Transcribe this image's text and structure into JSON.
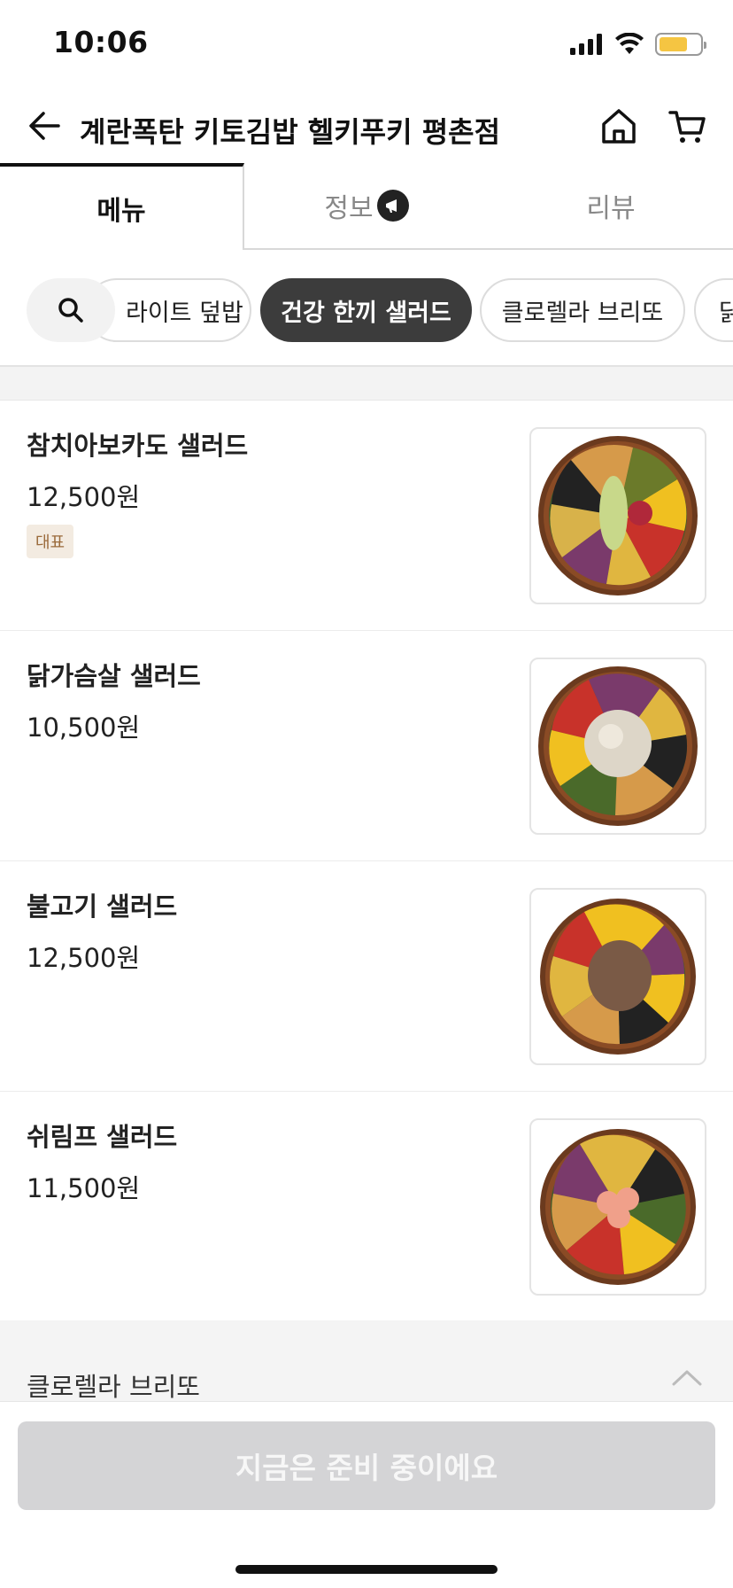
{
  "status_bar": {
    "time": "10:06",
    "icons": [
      "cellular-signal-icon",
      "wifi-icon",
      "battery-icon"
    ],
    "battery_color": "#f5c542"
  },
  "header": {
    "store_title": "계란폭탄 키토김밥 헬키푸키 평촌점",
    "icons": [
      "back-arrow-icon",
      "home-icon",
      "cart-icon"
    ]
  },
  "tabs": [
    {
      "label": "메뉴",
      "active": true
    },
    {
      "label": "정보",
      "active": false,
      "icon": "megaphone-icon"
    },
    {
      "label": "리뷰",
      "active": false
    }
  ],
  "categories": {
    "search_icon": "search-icon",
    "chips": [
      {
        "label": "라이트 덮밥",
        "display": "라이트 덮밥",
        "active": false
      },
      {
        "label": "건강 한끼 샐러드",
        "active": true
      },
      {
        "label": "클로렐라 브리또",
        "active": false
      },
      {
        "label": "닭",
        "active": false
      }
    ]
  },
  "menu_items": [
    {
      "name": "참치아보카도 샐러드",
      "price": "12,500원",
      "badge": "대표",
      "image": "tuna-avocado-salad-bowl"
    },
    {
      "name": "닭가슴살 샐러드",
      "price": "10,500원",
      "image": "chicken-breast-salad-bowl"
    },
    {
      "name": "불고기 샐러드",
      "price": "12,500원",
      "image": "bulgogi-salad-bowl"
    },
    {
      "name": "쉬림프 샐러드",
      "price": "11,500원",
      "image": "shrimp-salad-bowl"
    }
  ],
  "collapsed_section": {
    "title": "클로렐라 브리또",
    "icon": "chevron-up-icon"
  },
  "cta": {
    "label": "지금은 준비 중이에요",
    "disabled": true,
    "color": "#d4d4d6"
  }
}
